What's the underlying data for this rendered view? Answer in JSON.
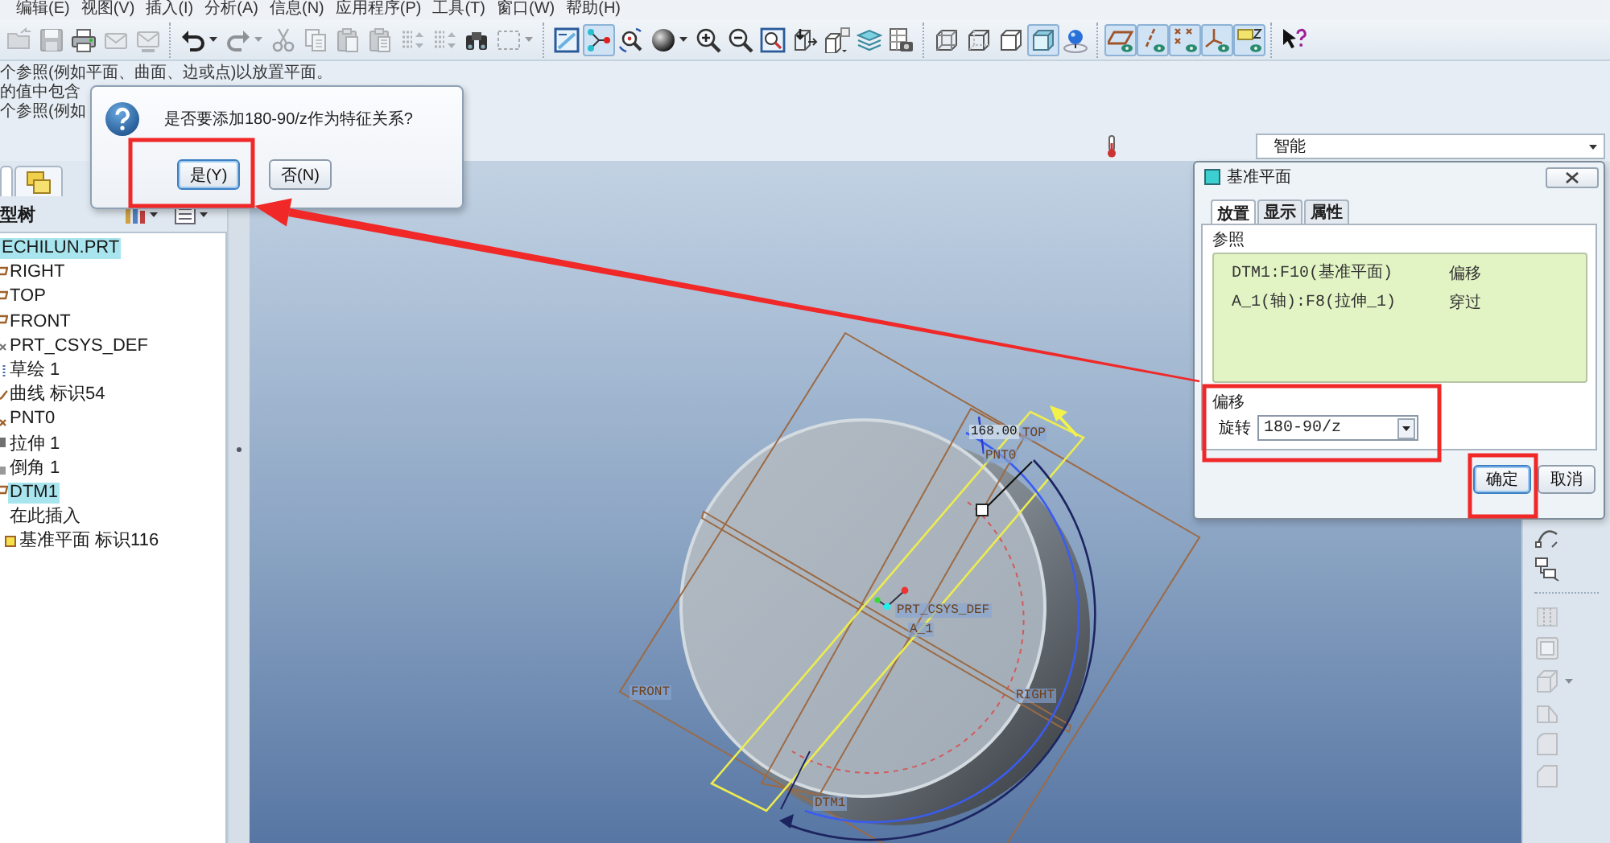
{
  "menu_bar": [
    "编辑(E)",
    "视图(V)",
    "插入(I)",
    "分析(A)",
    "信息(N)",
    "应用程序(P)",
    "工具(T)",
    "窗口(W)",
    "帮助(H)"
  ],
  "toolbar": [
    [
      {
        "kind": "open",
        "disabled": true,
        "on": false,
        "menu": false
      },
      {
        "kind": "save",
        "disabled": true,
        "on": false,
        "menu": false
      },
      {
        "kind": "print",
        "disabled": false,
        "on": false,
        "menu": false
      },
      {
        "kind": "mail",
        "disabled": true,
        "on": false,
        "menu": false
      },
      {
        "kind": "mail-link",
        "disabled": true,
        "on": false,
        "menu": false
      }
    ],
    [
      {
        "kind": "undo",
        "disabled": false,
        "on": false,
        "menu": true
      },
      {
        "kind": "redo",
        "disabled": true,
        "on": false,
        "menu": true
      },
      {
        "kind": "cut",
        "disabled": true,
        "on": false,
        "menu": false
      },
      {
        "kind": "copy",
        "disabled": true,
        "on": false,
        "menu": false
      },
      {
        "kind": "paste",
        "disabled": true,
        "on": false,
        "menu": false
      },
      {
        "kind": "paste-special",
        "disabled": true,
        "on": false,
        "menu": false
      },
      {
        "kind": "regenerate",
        "disabled": true,
        "on": false,
        "menu": false
      },
      {
        "kind": "regenerate-manager",
        "disabled": true,
        "on": false,
        "menu": false
      },
      {
        "kind": "find",
        "disabled": false,
        "on": false,
        "menu": false
      },
      {
        "kind": "select-box",
        "disabled": true,
        "on": false,
        "menu": true
      }
    ],
    [
      {
        "kind": "repaint",
        "disabled": false,
        "on": false,
        "menu": false
      },
      {
        "kind": "spin-center",
        "disabled": false,
        "on": true,
        "menu": false
      },
      {
        "kind": "orient",
        "disabled": false,
        "on": false,
        "menu": false
      },
      {
        "kind": "display-style",
        "disabled": false,
        "on": false,
        "menu": true
      },
      {
        "kind": "zoom-in",
        "disabled": false,
        "on": false,
        "menu": false
      },
      {
        "kind": "zoom-out",
        "disabled": false,
        "on": false,
        "menu": false
      },
      {
        "kind": "refit",
        "disabled": false,
        "on": false,
        "menu": false
      },
      {
        "kind": "reorient",
        "disabled": false,
        "on": false,
        "menu": false
      },
      {
        "kind": "saved-views",
        "disabled": false,
        "on": false,
        "menu": false
      },
      {
        "kind": "layers",
        "disabled": false,
        "on": false,
        "menu": false
      },
      {
        "kind": "view-manager",
        "disabled": false,
        "on": false,
        "menu": false
      }
    ],
    [
      {
        "kind": "wireframe",
        "disabled": false,
        "on": false,
        "menu": false
      },
      {
        "kind": "hidden-line",
        "disabled": false,
        "on": false,
        "menu": false
      },
      {
        "kind": "no-hidden",
        "disabled": false,
        "on": false,
        "menu": false
      },
      {
        "kind": "shading",
        "disabled": false,
        "on": true,
        "menu": false
      },
      {
        "kind": "realism",
        "disabled": false,
        "on": false,
        "menu": false
      }
    ],
    [
      {
        "kind": "datum-planes",
        "disabled": false,
        "on": true,
        "menu": false
      },
      {
        "kind": "datum-axes",
        "disabled": false,
        "on": true,
        "menu": false
      },
      {
        "kind": "datum-points",
        "disabled": false,
        "on": true,
        "menu": false
      },
      {
        "kind": "csys",
        "disabled": false,
        "on": true,
        "menu": false
      },
      {
        "kind": "annotations",
        "disabled": false,
        "on": true,
        "menu": false
      }
    ],
    [
      {
        "kind": "help",
        "disabled": false,
        "on": false,
        "menu": false
      }
    ]
  ],
  "message_area": {
    "lines": [
      "个参照(例如平面、曲面、边或点)以放置平面。",
      "的值中包含",
      "个参照(例如"
    ]
  },
  "confirm_dialog": {
    "message": "是否要添加180-90/z作为特征关系?",
    "buttons": [
      {
        "label": "是(Y)",
        "default": true
      },
      {
        "label": "否(N)",
        "default": false
      }
    ]
  },
  "filter": {
    "value": "智能"
  },
  "model_tree": {
    "title": "型树",
    "items": [
      {
        "label": "ECHILUN.PRT",
        "selected": true,
        "children": [
          {
            "label": "RIGHT",
            "kind": "plane",
            "selected": false
          },
          {
            "label": "TOP",
            "kind": "plane",
            "selected": false
          },
          {
            "label": "FRONT",
            "kind": "plane",
            "selected": false
          },
          {
            "label": "PRT_CSYS_DEF",
            "kind": "csys",
            "selected": false
          },
          {
            "label": "草绘 1",
            "kind": "sketch",
            "selected": false
          },
          {
            "label": "曲线 标识54",
            "kind": "curve",
            "selected": false
          },
          {
            "label": "PNT0",
            "kind": "point",
            "selected": false
          },
          {
            "label": "拉伸 1",
            "kind": "extrude",
            "selected": false
          },
          {
            "label": "倒角 1",
            "kind": "chamfer",
            "selected": false
          },
          {
            "label": "DTM1",
            "kind": "plane",
            "selected": true
          },
          {
            "label": "在此插入",
            "kind": "insert",
            "selected": false
          },
          {
            "label": "基准平面 标识116",
            "kind": "new-plane",
            "selected": false
          }
        ]
      }
    ]
  },
  "viewport": {
    "labels": [
      {
        "text": "168.00",
        "kind": "dimension"
      },
      {
        "text": "TOP",
        "kind": "datum"
      },
      {
        "text": "PNT0",
        "kind": "datum"
      },
      {
        "text": "PRT_CSYS_DEF",
        "kind": "datum"
      },
      {
        "text": "A_1",
        "kind": "datum"
      },
      {
        "text": "FRONT",
        "kind": "datum"
      },
      {
        "text": "RIGHT",
        "kind": "datum"
      },
      {
        "text": "DTM1",
        "kind": "datum"
      }
    ]
  },
  "feature_toolbar": [
    [
      {
        "kind": "curve",
        "disabled": false,
        "menu": false
      },
      {
        "kind": "analysis",
        "disabled": false,
        "menu": false
      }
    ],
    [
      {
        "kind": "hole",
        "disabled": true,
        "menu": false
      },
      {
        "kind": "shell",
        "disabled": true,
        "menu": false
      },
      {
        "kind": "rib",
        "disabled": true,
        "menu": true
      },
      {
        "kind": "draft",
        "disabled": true,
        "menu": false
      },
      {
        "kind": "round",
        "disabled": true,
        "menu": false
      },
      {
        "kind": "chamfer",
        "disabled": true,
        "menu": false
      }
    ]
  ],
  "datum_dialog": {
    "title": "基准平面",
    "tabs": [
      {
        "label": "放置",
        "selected": true
      },
      {
        "label": "显示",
        "selected": false
      },
      {
        "label": "属性",
        "selected": false
      }
    ],
    "references_label": "参照",
    "references": [
      {
        "reference": "DTM1:F10(基准平面)",
        "constraint": "偏移"
      },
      {
        "reference": "A_1(轴):F8(拉伸_1)",
        "constraint": "穿过"
      }
    ],
    "offset_label": "偏移",
    "rotation_label": "旋转",
    "rotation_value": "180-90/z",
    "buttons": [
      {
        "label": "确定",
        "default": true
      },
      {
        "label": "取消",
        "default": false
      }
    ]
  }
}
